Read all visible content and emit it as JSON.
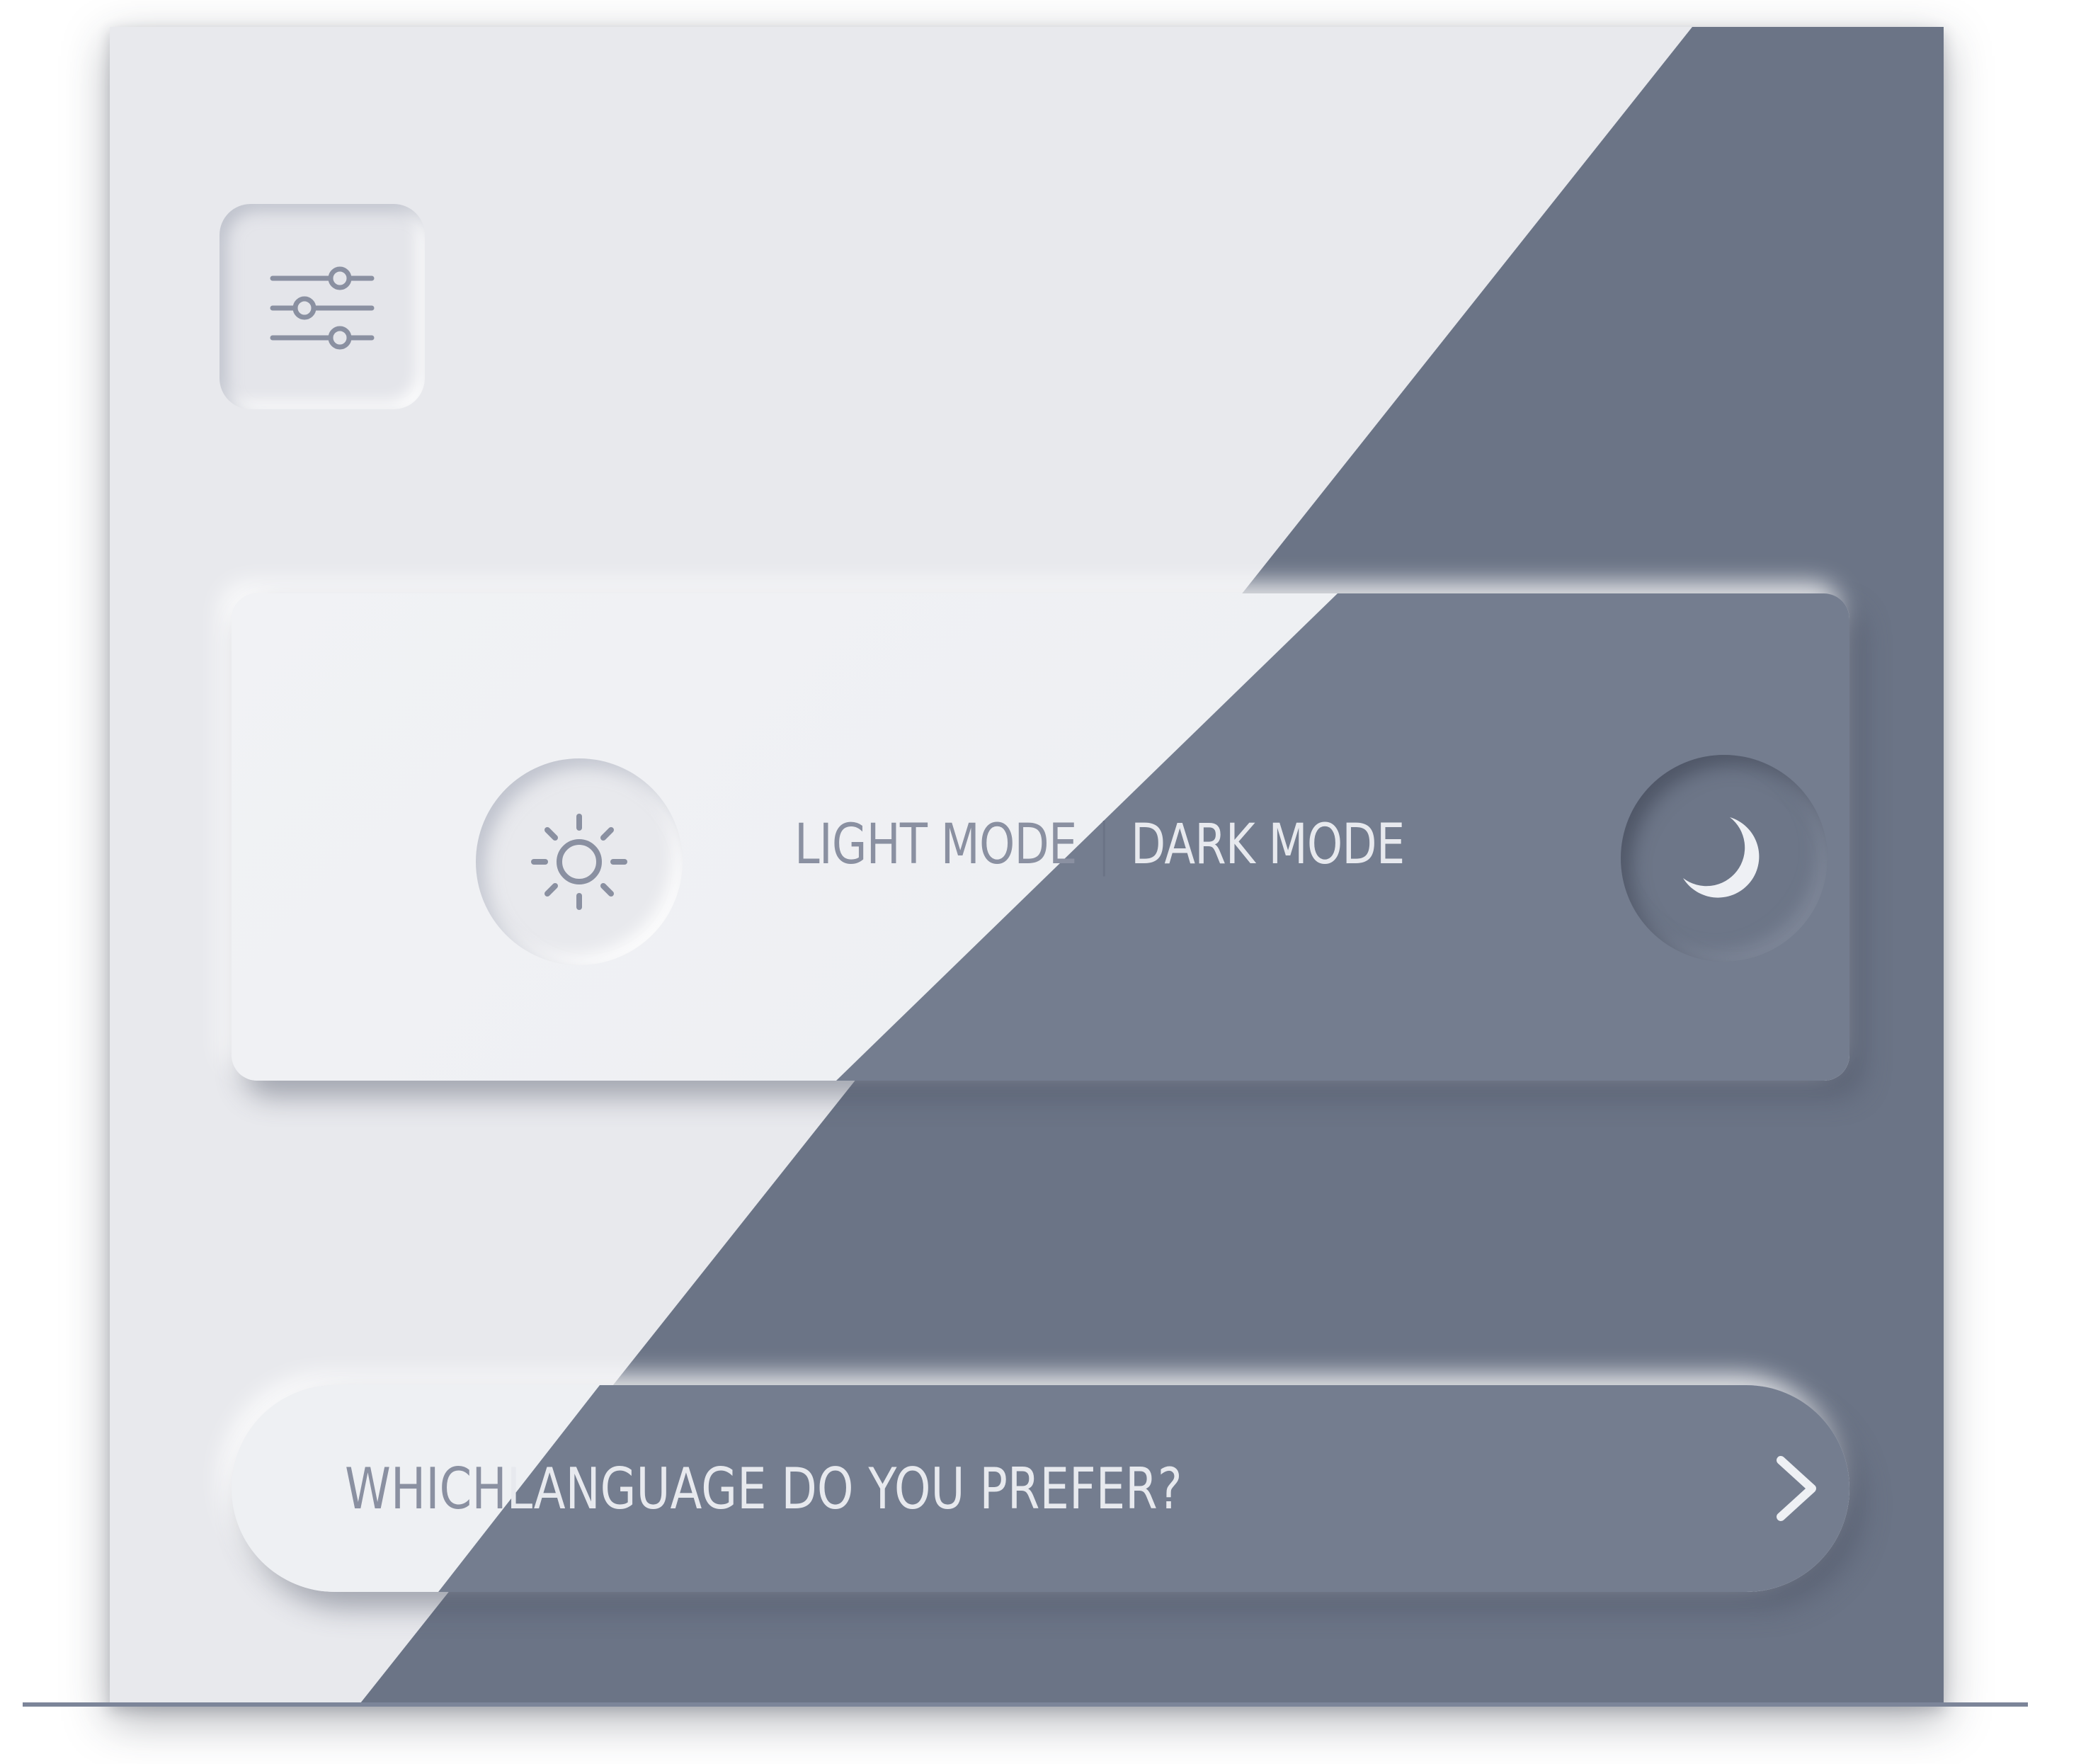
{
  "settings": {
    "icon": "sliders-icon"
  },
  "theme": {
    "light_label": "LIGHT MODE",
    "separator": "|",
    "dark_label": "DARK MODE",
    "light_icon": "sun-icon",
    "dark_icon": "moon-icon"
  },
  "language": {
    "prompt_light_part": "WHICH",
    "prompt_dark_part": " LANGUAGE DO YOU PREFER?",
    "icon": "chevron-right-icon"
  },
  "colors": {
    "light_bg": "#e8e9ed",
    "dark_bg": "#6b7486",
    "light_text": "#8a90a1",
    "dark_text": "#e7e9ee"
  }
}
